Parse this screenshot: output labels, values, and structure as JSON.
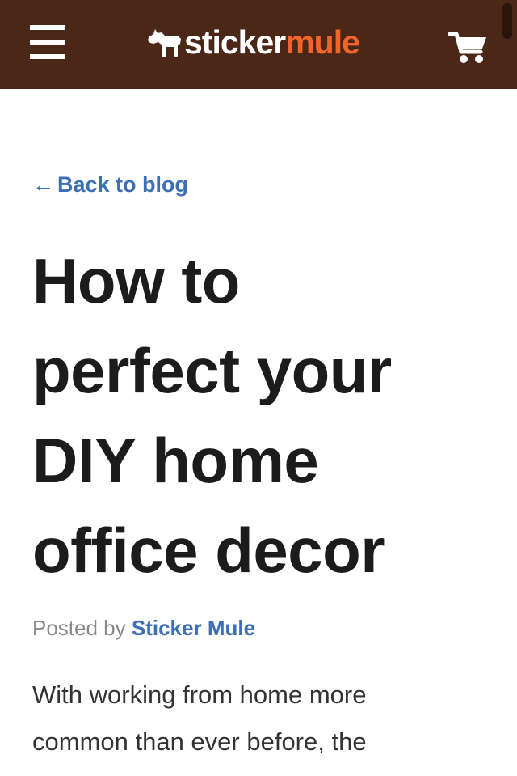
{
  "header": {
    "logo_sticker": "sticker",
    "logo_mule": "mule",
    "brand_color": "#4b2718",
    "accent_color": "#f1652b",
    "icons": [
      "menu-icon",
      "mule-logo-icon",
      "cart-icon"
    ]
  },
  "nav": {
    "back_arrow": "←",
    "back_label": "Back to blog"
  },
  "article": {
    "title": "How to perfect your DIY home office decor",
    "byline_prefix": "Posted by",
    "author": "Sticker Mule",
    "intro": "With working from home more common than ever before, the"
  },
  "colors": {
    "link": "#3c6fb4",
    "title": "#1c1c1c",
    "body": "#333333",
    "muted": "#8a8a8a"
  }
}
